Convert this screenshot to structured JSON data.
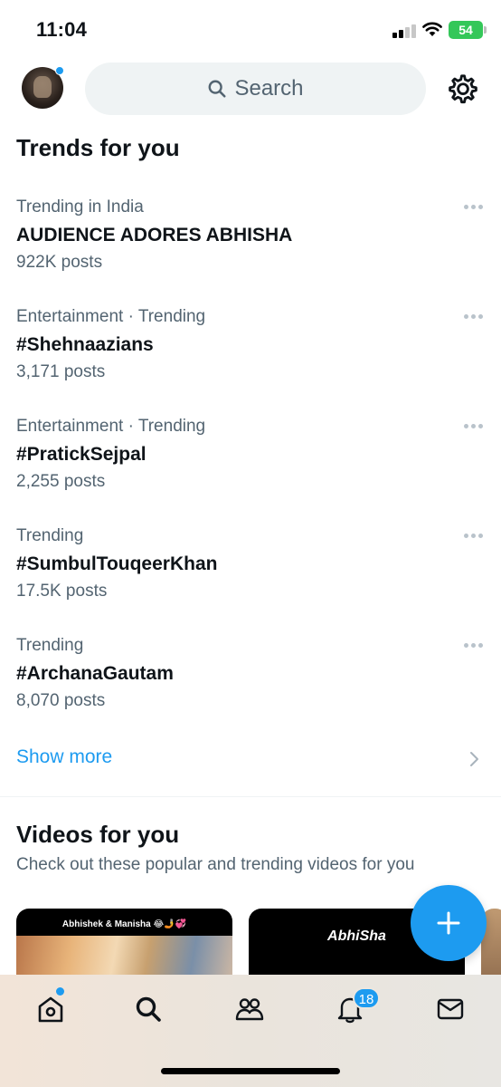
{
  "status": {
    "time": "11:04",
    "battery": "54"
  },
  "search": {
    "placeholder": "Search"
  },
  "trends": {
    "title": "Trends for you",
    "items": [
      {
        "meta": "Trending in India",
        "name": "AUDIENCE ADORES ABHISHA",
        "count": "922K posts"
      },
      {
        "meta": "Entertainment · Trending",
        "name": "#Shehnaazians",
        "count": "3,171 posts"
      },
      {
        "meta": "Entertainment · Trending",
        "name": "#PratickSejpal",
        "count": "2,255 posts"
      },
      {
        "meta": "Trending",
        "name": "#SumbulTouqeerKhan",
        "count": "17.5K posts"
      },
      {
        "meta": "Trending",
        "name": "#ArchanaGautam",
        "count": "8,070 posts"
      }
    ],
    "show_more": "Show more"
  },
  "videos": {
    "title": "Videos for you",
    "subtitle": "Check out these popular and trending videos for you",
    "cards": [
      {
        "caption": "Abhishek & Manisha 😂🤳💞"
      },
      {
        "caption": "AbhiSha"
      }
    ]
  },
  "tabbar": {
    "notifications_badge": "18"
  },
  "colors": {
    "accent": "#1d9bf0",
    "text": "#0f1419",
    "secondary": "#536471"
  }
}
